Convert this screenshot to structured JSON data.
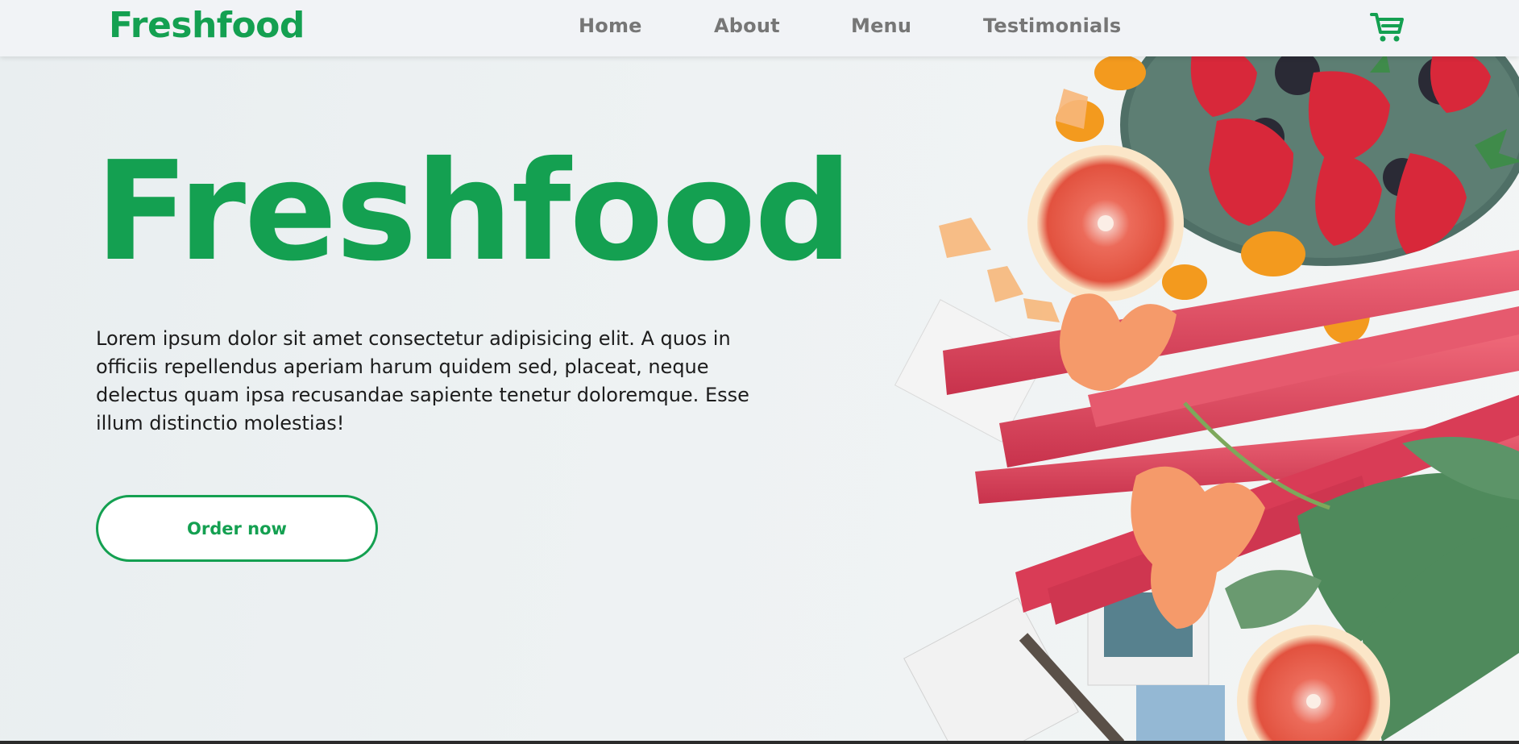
{
  "brand": {
    "name": "Freshfood",
    "color": "#14a051"
  },
  "nav": {
    "items": [
      {
        "label": "Home"
      },
      {
        "label": "About"
      },
      {
        "label": "Menu"
      },
      {
        "label": "Testimonials"
      }
    ],
    "cart_icon": "shopping-cart-icon"
  },
  "hero": {
    "title": "Freshfood",
    "description": "Lorem ipsum dolor sit amet consectetur adipisicing elit. A quos in officiis repellendus aperiam harum quidem sed, placeat, neque delectus quam ipsa recusandae sapiente tenetur doloremque. Esse illum distinctio molestias!",
    "cta_label": "Order now"
  },
  "colors": {
    "accent": "#14a051",
    "nav_text": "#767676",
    "header_bg": "#f1f3f6"
  }
}
